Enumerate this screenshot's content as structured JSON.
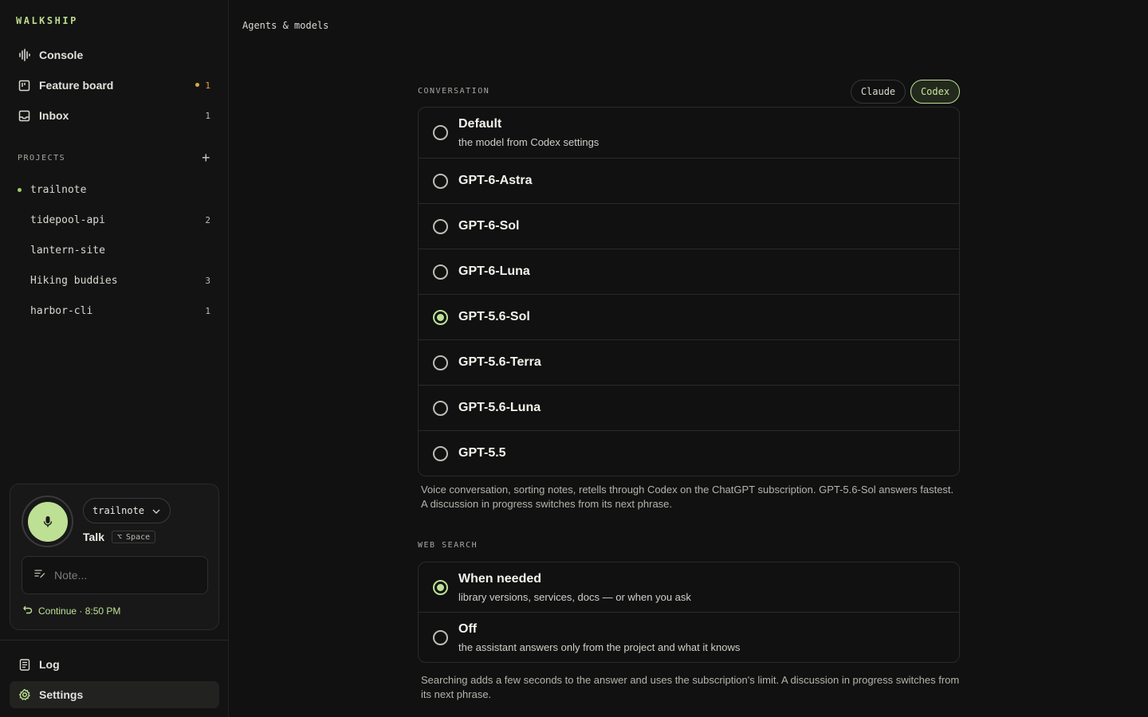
{
  "brand": "WALKSHIP",
  "nav": {
    "console": "Console",
    "feature_board": "Feature board",
    "feature_board_count": "1",
    "inbox": "Inbox",
    "inbox_count": "1"
  },
  "projects": {
    "heading": "PROJECTS",
    "items": [
      {
        "label": "trailnote",
        "count": "",
        "active": true
      },
      {
        "label": "tidepool-api",
        "count": "2"
      },
      {
        "label": "lantern-site",
        "count": ""
      },
      {
        "label": "Hiking buddies",
        "count": "3"
      },
      {
        "label": "harbor-cli",
        "count": "1"
      }
    ]
  },
  "talk": {
    "project": "trailnote",
    "label": "Talk",
    "shortcut_key": "⌥",
    "shortcut": "Space",
    "note_placeholder": "Note...",
    "continue": "Continue · 8:50 PM"
  },
  "footer_nav": {
    "log": "Log",
    "settings": "Settings"
  },
  "main": {
    "breadcrumb": "Agents & models",
    "conversation": {
      "label": "CONVERSATION",
      "providers": [
        "Claude",
        "Codex"
      ],
      "selected_provider": "Codex",
      "options": [
        {
          "title": "Default",
          "sub": "the model from Codex settings",
          "selected": false
        },
        {
          "title": "GPT-6-Astra",
          "selected": false
        },
        {
          "title": "GPT-6-Sol",
          "selected": false
        },
        {
          "title": "GPT-6-Luna",
          "selected": false
        },
        {
          "title": "GPT-5.6-Sol",
          "selected": true
        },
        {
          "title": "GPT-5.6-Terra",
          "selected": false
        },
        {
          "title": "GPT-5.6-Luna",
          "selected": false
        },
        {
          "title": "GPT-5.5",
          "selected": false
        }
      ],
      "help": "Voice conversation, sorting notes, retells through Codex on the ChatGPT subscription. GPT-5.6-Sol answers fastest. A discussion in progress switches from its next phrase."
    },
    "web_search": {
      "label": "WEB SEARCH",
      "options": [
        {
          "title": "When needed",
          "sub": "library versions, services, docs — or when you ask",
          "selected": true
        },
        {
          "title": "Off",
          "sub": "the assistant answers only from the project and what it knows",
          "selected": false
        }
      ],
      "help": "Searching adds a few seconds to the answer and uses the subscription's limit. A discussion in progress switches from its next phrase."
    }
  },
  "colors": {
    "accent": "#bde095",
    "badge": "#e0a64a",
    "background": "#111111"
  }
}
